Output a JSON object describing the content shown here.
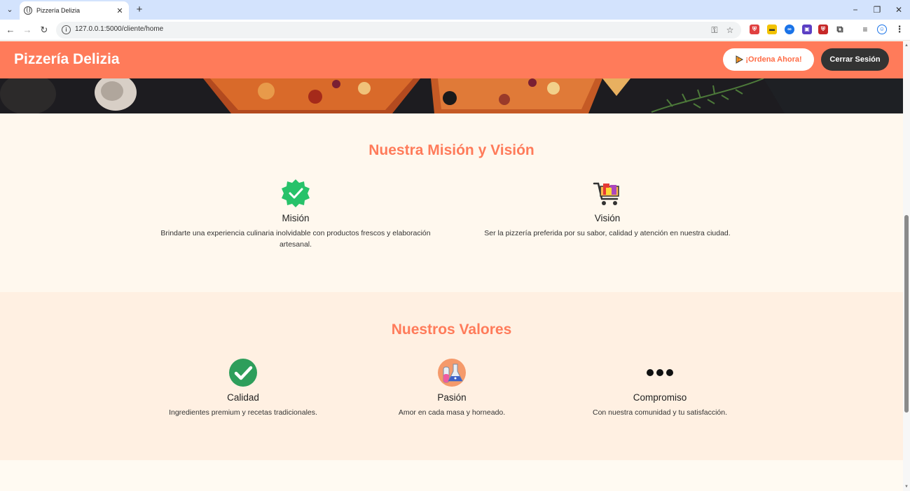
{
  "browser": {
    "tab_title": "Pizzería Delizia",
    "url": "127.0.0.1:5000/cliente/home"
  },
  "header": {
    "brand": "Pizzería Delizia",
    "order_button": "¡Ordena Ahora!",
    "logout_button": "Cerrar Sesión",
    "brand_color": "#ff7b5a"
  },
  "mission_vision": {
    "title": "Nuestra Misión y Visión",
    "items": [
      {
        "icon": "verified-badge-icon",
        "title": "Misión",
        "text": "Brindarte una experiencia culinaria inolvidable con productos frescos y elaboración artesanal."
      },
      {
        "icon": "shopping-cart-icon",
        "title": "Visión",
        "text": "Ser la pizzería preferida por su sabor, calidad y atención en nuestra ciudad."
      }
    ]
  },
  "values": {
    "title": "Nuestros Valores",
    "items": [
      {
        "icon": "check-circle-icon",
        "title": "Calidad",
        "text": "Ingredientes premium y recetas tradicionales."
      },
      {
        "icon": "lab-flask-icon",
        "title": "Pasión",
        "text": "Amor en cada masa y horneado."
      },
      {
        "icon": "dots-icon",
        "title": "Compromiso",
        "text": "Con nuestra comunidad y tu satisfacción."
      }
    ]
  }
}
